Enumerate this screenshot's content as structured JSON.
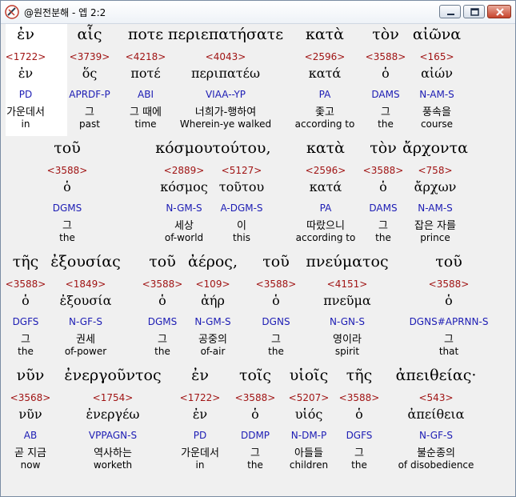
{
  "window": {
    "title": "@원전분해 - 엡 2:2"
  },
  "titlebar_icons": {
    "app": "app-logo-icon",
    "minimize": "minimize-icon",
    "maximize": "maximize-icon",
    "close": "close-icon"
  },
  "colors": {
    "number": "#a01414",
    "parse": "#1c1cb4",
    "highlight": "#ffffff"
  },
  "rows": [
    {
      "words": [
        {
          "greek": "ἐν",
          "num": "<1722>",
          "lemma": "ἐν",
          "parse": "PD",
          "kor": "가운데서",
          "eng": "in"
        },
        {
          "greek": "αἷς",
          "num": "<3739>",
          "lemma": "ὅς",
          "parse": "APRDF-P",
          "kor": "그",
          "eng": "past"
        },
        {
          "greek": "ποτε",
          "num": "<4218>",
          "lemma": "ποτέ",
          "parse": "ABI",
          "kor": "그 때에",
          "eng": "time"
        },
        {
          "greek": "περιεπατήσατε",
          "num": "<4043>",
          "lemma": "περιπατέω",
          "parse": "VIAA--YP",
          "kor": "너희가-행하여",
          "eng": "Wherein-ye walked"
        },
        {
          "greek": "κατὰ",
          "num": "<2596>",
          "lemma": "κατά",
          "parse": "PA",
          "kor": "좇고",
          "eng": "according to"
        },
        {
          "greek": "τὸν",
          "num": "<3588>",
          "lemma": "ὁ",
          "parse": "DAMS",
          "kor": "그",
          "eng": "the"
        },
        {
          "greek": "αἰῶνα",
          "num": "<165>",
          "lemma": "αἰών",
          "parse": "N-AM-S",
          "kor": "풍속을",
          "eng": "course"
        }
      ]
    },
    {
      "words": [
        {
          "greek": "τοῦ",
          "num": "<3588>",
          "lemma": "ὁ",
          "parse": "DGMS",
          "kor": "그",
          "eng": "the"
        },
        {
          "greek": "κόσμου",
          "num": "<2889>",
          "lemma": "κόσμος",
          "parse": "N-GM-S",
          "kor": "세상",
          "eng": "of-world"
        },
        {
          "greek": "τούτου,",
          "num": "<5127>",
          "lemma": "τοῦτου",
          "parse": "A-DGM-S",
          "kor": "이",
          "eng": "this"
        },
        {
          "greek": "κατὰ",
          "num": "<2596>",
          "lemma": "κατά",
          "parse": "PA",
          "kor": "따랐으니",
          "eng": "according to"
        },
        {
          "greek": "τὸν",
          "num": "<3588>",
          "lemma": "ὁ",
          "parse": "DAMS",
          "kor": "그",
          "eng": "the"
        },
        {
          "greek": "ἄρχοντα",
          "num": "<758>",
          "lemma": "ἄρχων",
          "parse": "N-AM-S",
          "kor": "잡은 자를",
          "eng": "prince"
        }
      ]
    },
    {
      "words": [
        {
          "greek": "τῆς",
          "num": "<3588>",
          "lemma": "ὁ",
          "parse": "DGFS",
          "kor": "그",
          "eng": "the"
        },
        {
          "greek": "ἐξουσίας",
          "num": "<1849>",
          "lemma": "ἐξουσία",
          "parse": "N-GF-S",
          "kor": "권세",
          "eng": "of-power"
        },
        {
          "greek": "τοῦ",
          "num": "<3588>",
          "lemma": "ὁ",
          "parse": "DGMS",
          "kor": "그",
          "eng": "the"
        },
        {
          "greek": "ἀέρος,",
          "num": "<109>",
          "lemma": "ἀήρ",
          "parse": "N-GM-S",
          "kor": "공중의",
          "eng": "of-air"
        },
        {
          "greek": "τοῦ",
          "num": "<3588>",
          "lemma": "ὁ",
          "parse": "DGNS",
          "kor": "그",
          "eng": "the"
        },
        {
          "greek": "πνεύματος",
          "num": "<4151>",
          "lemma": "πνεῦμα",
          "parse": "N-GN-S",
          "kor": "영이라",
          "eng": "spirit"
        },
        {
          "greek": "τοῦ",
          "num": "<3588>",
          "lemma": "ὁ",
          "parse": "DGNS#APRNN-S",
          "kor": "그",
          "eng": "that"
        }
      ]
    },
    {
      "words": [
        {
          "greek": "νῦν",
          "num": "<3568>",
          "lemma": "νῦν",
          "parse": "AB",
          "kor": "곧 지금",
          "eng": "now"
        },
        {
          "greek": "ἐνεργοῦντος",
          "num": "<1754>",
          "lemma": "ἐνεργέω",
          "parse": "VPPAGN-S",
          "kor": "역사하는",
          "eng": "worketh"
        },
        {
          "greek": "ἐν",
          "num": "<1722>",
          "lemma": "ἐν",
          "parse": "PD",
          "kor": "가운데서",
          "eng": "in"
        },
        {
          "greek": "τοῖς",
          "num": "<3588>",
          "lemma": "ὁ",
          "parse": "DDMP",
          "kor": "그",
          "eng": "the"
        },
        {
          "greek": "υἱοῖς",
          "num": "<5207>",
          "lemma": "υἱός",
          "parse": "N-DM-P",
          "kor": "아들들",
          "eng": "children"
        },
        {
          "greek": "τῆς",
          "num": "<3588>",
          "lemma": "ὁ",
          "parse": "DGFS",
          "kor": "그",
          "eng": "the"
        },
        {
          "greek": "ἀπειθείας·",
          "num": "<543>",
          "lemma": "ἀπείθεια",
          "parse": "N-GF-S",
          "kor": "불순종의",
          "eng": "of disobedience"
        }
      ]
    }
  ]
}
